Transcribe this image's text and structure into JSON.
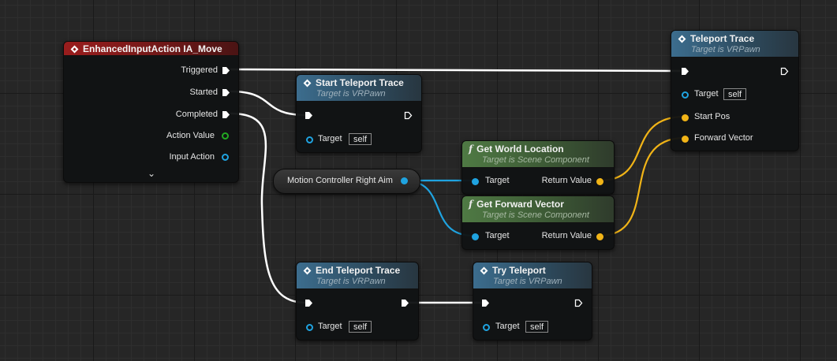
{
  "colors": {
    "exec": "#ffffff",
    "object_pin": "#1fa3e0",
    "vector_pin": "#f1b417",
    "struct_pin": "#22aa22",
    "event_header": "#9a1d1d",
    "function_header": "#3c6d8e",
    "pure_header": "#4f7a44"
  },
  "event_node": {
    "title": "EnhancedInputAction IA_Move",
    "icon": "event-diamond-icon",
    "pins": {
      "triggered": "Triggered",
      "started": "Started",
      "completed": "Completed",
      "action_value": "Action Value",
      "input_action": "Input Action"
    },
    "expand_icon": "chevron-down-icon"
  },
  "start_trace": {
    "title": "Start Teleport Trace",
    "subtitle": "Target is VRPawn",
    "target_label": "Target",
    "target_value": "self"
  },
  "teleport_trace": {
    "title": "Teleport Trace",
    "subtitle": "Target is VRPawn",
    "target_label": "Target",
    "target_value": "self",
    "start_pos": "Start Pos",
    "forward_vector": "Forward Vector"
  },
  "get_world_location": {
    "icon": "f",
    "title": "Get World Location",
    "subtitle": "Target is Scene Component",
    "target_label": "Target",
    "return_label": "Return Value"
  },
  "get_forward_vector": {
    "icon": "f",
    "title": "Get Forward Vector",
    "subtitle": "Target is Scene Component",
    "target_label": "Target",
    "return_label": "Return Value"
  },
  "variable_getter": {
    "label": "Motion Controller Right Aim"
  },
  "end_trace": {
    "title": "End Teleport Trace",
    "subtitle": "Target is VRPawn",
    "target_label": "Target",
    "target_value": "self"
  },
  "try_teleport": {
    "title": "Try Teleport",
    "subtitle": "Target is VRPawn",
    "target_label": "Target",
    "target_value": "self"
  }
}
